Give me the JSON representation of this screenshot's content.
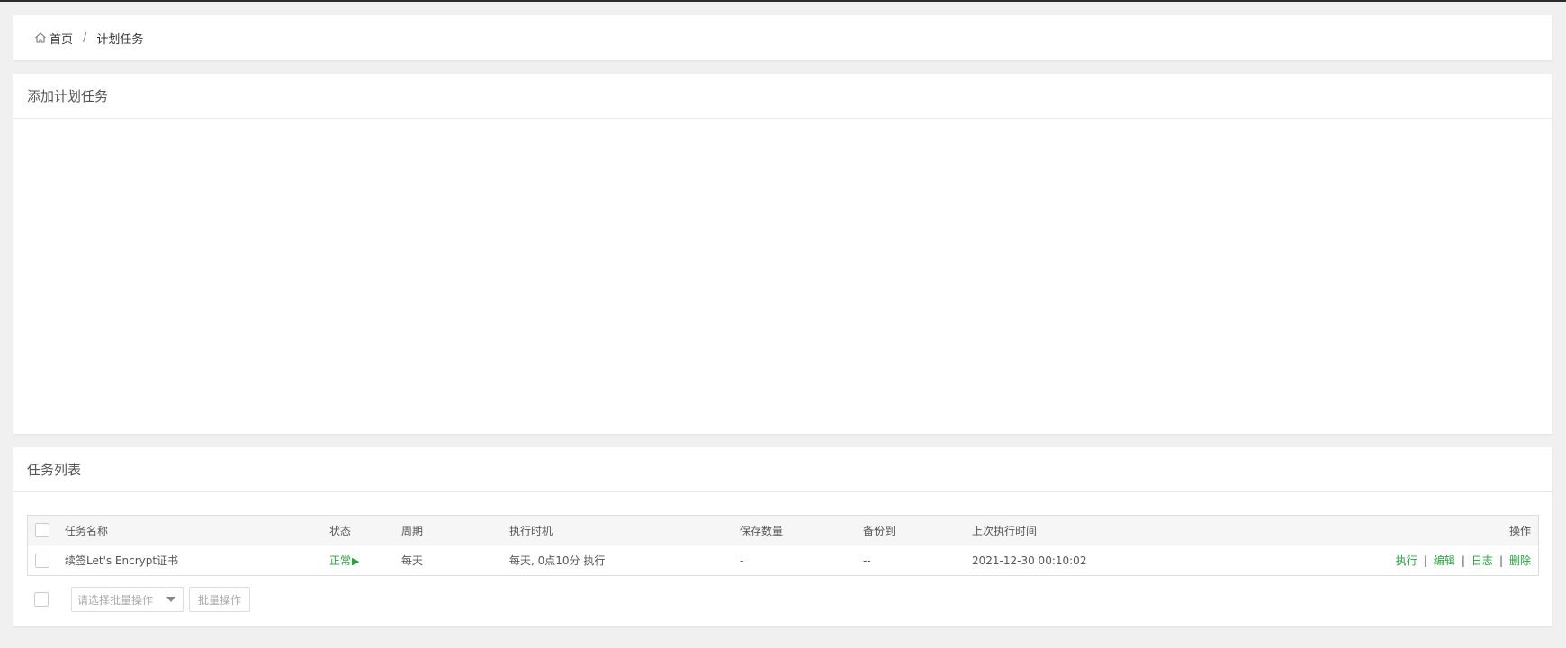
{
  "breadcrumb": {
    "home": "首页",
    "separator": "/",
    "current": "计划任务"
  },
  "add_panel": {
    "title": "添加计划任务"
  },
  "list_panel": {
    "title": "任务列表",
    "columns": [
      "任务名称",
      "状态",
      "周期",
      "执行时机",
      "保存数量",
      "备份到",
      "上次执行时间",
      "操作"
    ],
    "rows": [
      {
        "name": "续签Let's Encrypt证书",
        "status": "正常",
        "status_icon": "play-icon",
        "cycle": "每天",
        "timing": "每天, 0点10分 执行",
        "keep": "-",
        "backup": "--",
        "last_run": "2021-12-30 00:10:02",
        "ops": [
          "执行",
          "编辑",
          "日志",
          "删除"
        ]
      }
    ],
    "ops_separator": "|",
    "batch": {
      "select_placeholder": "请选择批量操作",
      "button": "批量操作"
    }
  },
  "colors": {
    "accent": "#20a53a",
    "background": "#f0f0f0",
    "topbar": "#2c2c2c"
  }
}
